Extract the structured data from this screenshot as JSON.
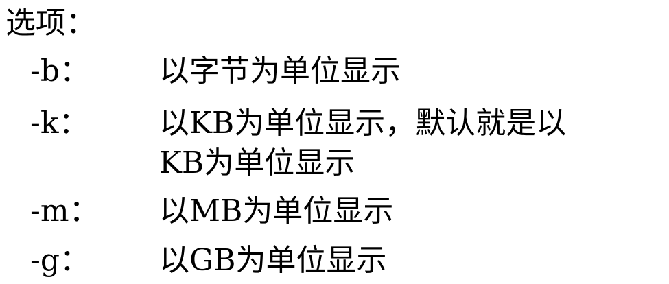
{
  "heading": "选项：",
  "options": [
    {
      "key": "-b：",
      "desc": "以字节为单位显示"
    },
    {
      "key": "-k：",
      "desc_line1": "以KB为单位显示，默认就是以",
      "desc_line2": "KB为单位显示"
    },
    {
      "key": "-m：",
      "desc": "以MB为单位显示"
    },
    {
      "key": "-g：",
      "desc": "以GB为单位显示"
    }
  ]
}
